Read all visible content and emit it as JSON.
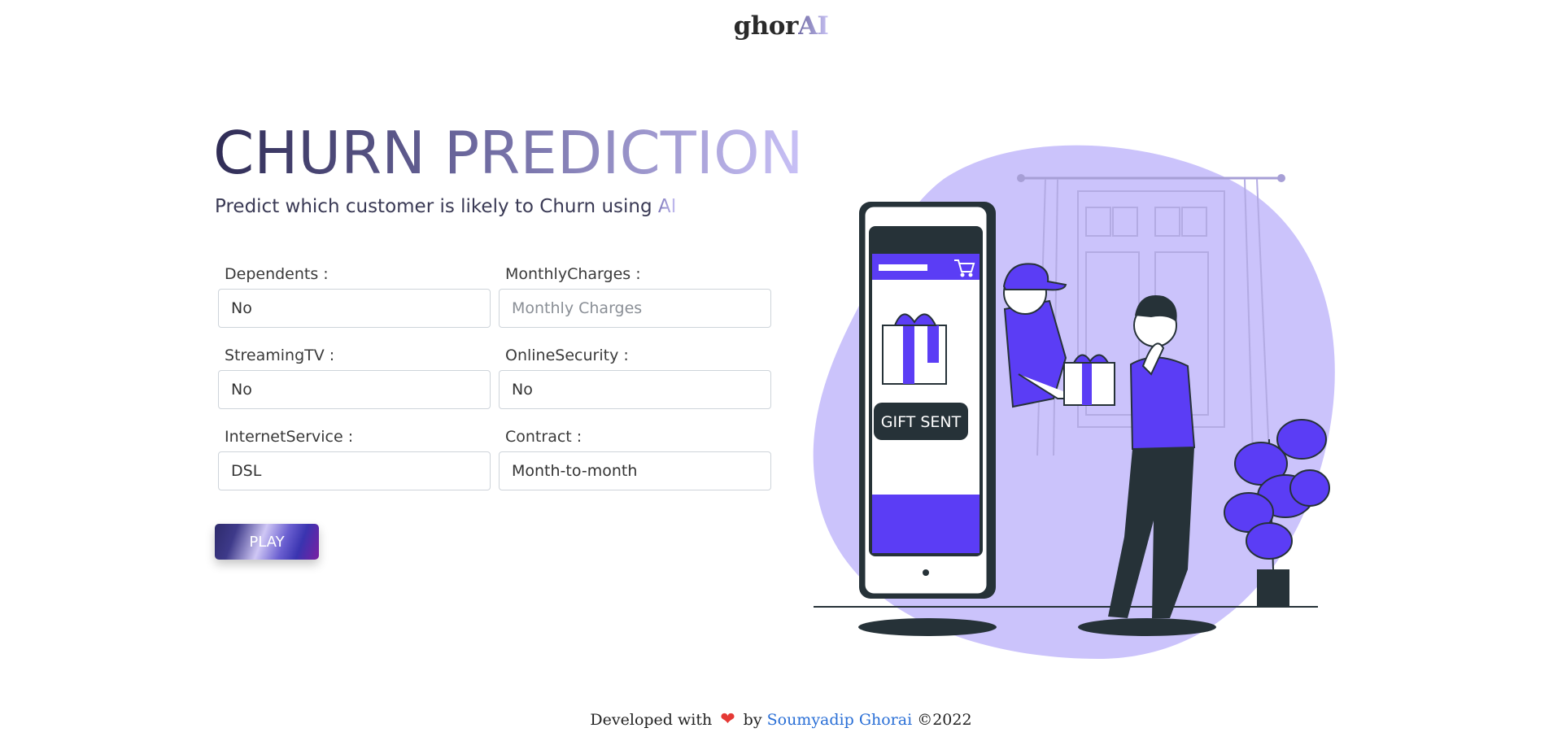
{
  "brand": {
    "name_part1": "ghor",
    "name_part2": "AI"
  },
  "hero": {
    "title": "CHURN PREDICTION",
    "subtitle_prefix": "Predict which customer is likely to Churn using ",
    "subtitle_ai": "AI"
  },
  "form": {
    "dependents": {
      "label": "Dependents :",
      "value": "No"
    },
    "monthly_charges": {
      "label": "MonthlyCharges :",
      "placeholder": "Monthly Charges"
    },
    "streaming_tv": {
      "label": "StreamingTV :",
      "value": "No"
    },
    "online_security": {
      "label": "OnlineSecurity :",
      "value": "No"
    },
    "internet_service": {
      "label": "InternetService :",
      "value": "DSL"
    },
    "contract": {
      "label": "Contract :",
      "value": "Month-to-month"
    },
    "submit_label": "PLAY"
  },
  "illustration": {
    "phone_button_label": "GIFT SENT",
    "icon": "shopping-cart-icon",
    "accent_color": "#5b3df5",
    "blob_color": "#cbc3fb"
  },
  "footer": {
    "prefix": "Developed with",
    "by": "by",
    "author": "Soumyadip Ghorai",
    "copyright": "©2022"
  },
  "colors": {
    "accent": "#5b3df5",
    "link": "#2a6fd6",
    "heart": "#e53935"
  }
}
